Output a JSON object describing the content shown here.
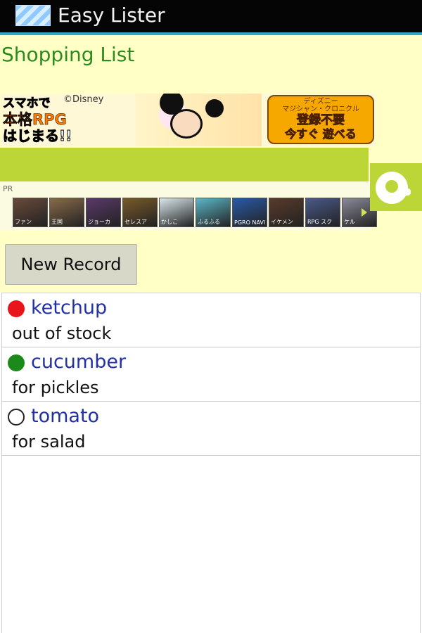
{
  "titlebar": {
    "app_title": "Easy Lister",
    "icon": "notepad-icon"
  },
  "page": {
    "title": "Shopping List"
  },
  "ad_banner": {
    "left_lines": [
      "スマホで",
      "本格RPG",
      "はじまる!!"
    ],
    "copyright": "©Disney",
    "right_lines": [
      "ディズニー",
      "マジシャン・クロニクル",
      "登録不要",
      "今すぐ 遊べる"
    ]
  },
  "ad_strip": {
    "pr_label": "PR",
    "thumbnails": [
      {
        "label": "ファン",
        "color": "#6b4a3a"
      },
      {
        "label": "王国",
        "color": "#8a6a4a"
      },
      {
        "label": "ジョーカ",
        "color": "#5a3a6a"
      },
      {
        "label": "セレスア",
        "color": "#7a5a2a"
      },
      {
        "label": "かしこ",
        "color": "#d9e6ea"
      },
      {
        "label": "ふるふる",
        "color": "#5ab6c8"
      },
      {
        "label": "PGRO NAVI",
        "color": "#2a5aa8"
      },
      {
        "label": "イケメン",
        "color": "#5a3a2a"
      },
      {
        "label": "RPG スク",
        "color": "#4a5a8a"
      },
      {
        "label": "ケル",
        "color": "#8a8a9a"
      }
    ]
  },
  "buttons": {
    "new_record": "New Record"
  },
  "colors": {
    "status_red": "#e8161c",
    "status_green": "#1b8a1b",
    "status_empty": "#ffffff"
  },
  "list": {
    "items": [
      {
        "name": "ketchup",
        "note": "out of stock",
        "status": "red"
      },
      {
        "name": "cucumber",
        "note": "for pickles",
        "status": "green"
      },
      {
        "name": "tomato",
        "note": "for salad",
        "status": "empty"
      }
    ]
  }
}
